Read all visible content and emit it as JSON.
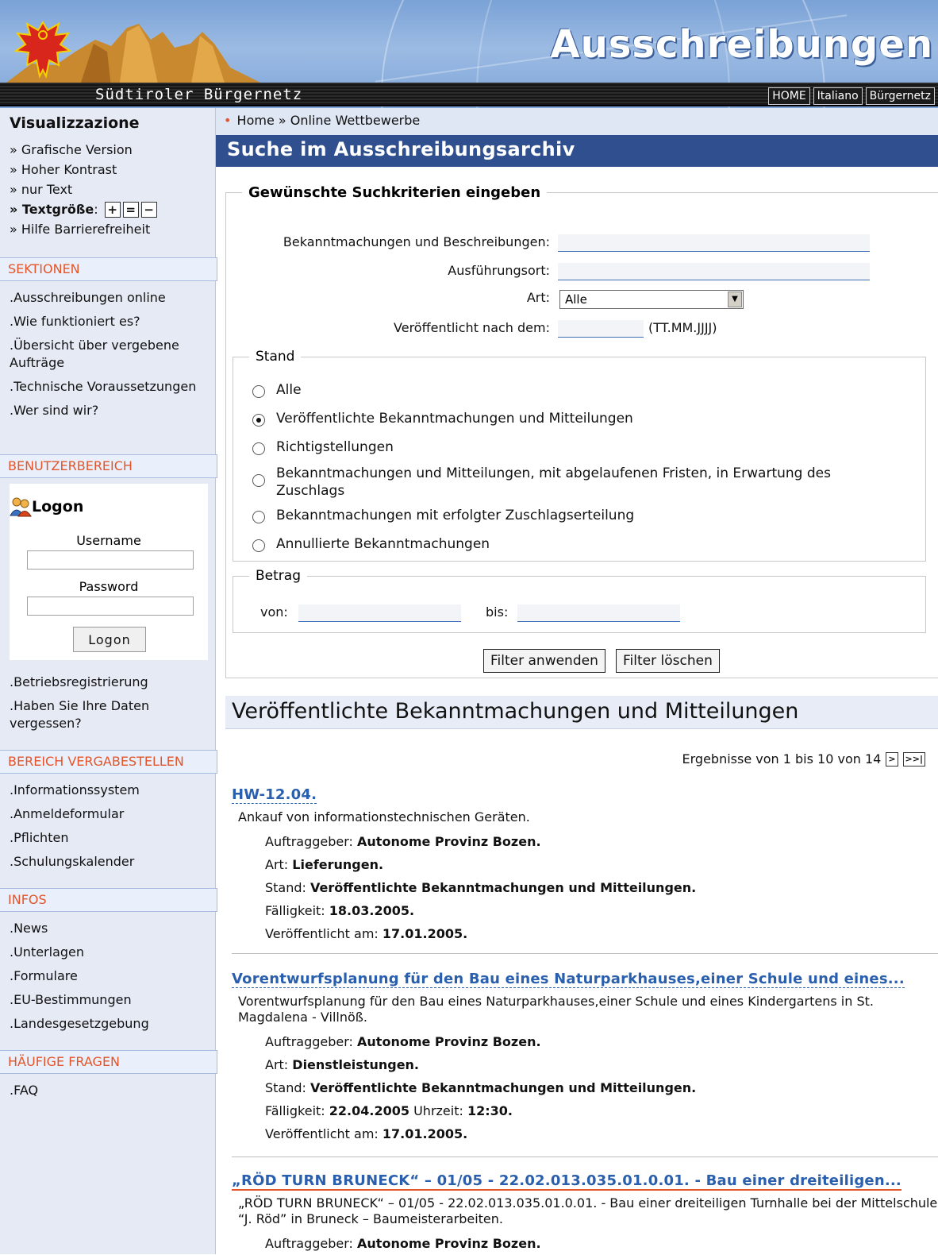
{
  "header": {
    "title": "Ausschreibungen",
    "site_name": "Südtiroler Bürgernetz",
    "links": [
      "HOME",
      "Italiano",
      "Bürgernetz"
    ]
  },
  "sidebar": {
    "visualization_title": "Visualizzazione",
    "visualization_items": [
      "» Grafische Version",
      "» Hoher Kontrast",
      "» nur Text"
    ],
    "text_size_label": "Textgröße",
    "text_size_buttons": [
      "+",
      "=",
      "−"
    ],
    "accessibility_help": "» Hilfe Barrierefreiheit",
    "sections": {
      "heading": "SEKTIONEN",
      "items": [
        ".Ausschreibungen online",
        ".Wie funktioniert es?",
        ".Übersicht über vergebene Aufträge",
        ".Technische Voraussetzungen",
        ".Wer sind wir?"
      ]
    },
    "user_area": {
      "heading": "BENUTZERBEREICH",
      "logon_title": "Logon",
      "username_label": "Username",
      "username_value": "",
      "password_label": "Password",
      "password_value": "",
      "logon_button": "Logon",
      "items": [
        ".Betriebsregistrierung",
        ".Haben Sie Ihre Daten vergessen?"
      ]
    },
    "contracting_area": {
      "heading": "BEREICH VERGABESTELLEN",
      "items": [
        ".Informationssystem",
        ".Anmeldeformular",
        ".Pflichten",
        ".Schulungskalender"
      ]
    },
    "infos": {
      "heading": "INFOS",
      "items": [
        ".News",
        ".Unterlagen",
        ".Formulare",
        ".EU-Bestimmungen",
        ".Landesgesetzgebung"
      ]
    },
    "faq": {
      "heading": "HÄUFIGE FRAGEN",
      "items": [
        ".FAQ"
      ]
    }
  },
  "breadcrumb": {
    "home": "Home",
    "sep": "»",
    "current": "Online Wettbewerbe"
  },
  "search": {
    "page_title": "Suche im Ausschreibungsarchiv",
    "legend": "Gewünschte Suchkriterien eingeben",
    "field_announcements_label": "Bekanntmachungen und Beschreibungen:",
    "field_announcements_value": "",
    "field_location_label": "Ausführungsort:",
    "field_location_value": "",
    "field_type_label": "Art:",
    "field_type_selected": "Alle",
    "field_published_label": "Veröffentlicht nach dem:",
    "field_published_value": "",
    "field_published_hint": "(TT.MM.JJJJ)",
    "status_legend": "Stand",
    "status_options": [
      "Alle",
      "Veröffentlichte Bekanntmachungen und Mitteilungen",
      "Richtigstellungen",
      "Bekanntmachungen und Mitteilungen, mit abgelaufenen Fristen, in Erwartung des Zuschlags",
      "Bekanntmachungen mit erfolgter Zuschlagserteilung",
      "Annullierte Bekanntmachungen"
    ],
    "status_selected": "Veröffentlichte Bekanntmachungen und Mitteilungen",
    "amount_legend": "Betrag",
    "amount_from_label": "von:",
    "amount_from_value": "",
    "amount_to_label": "bis:",
    "amount_to_value": "",
    "apply_button": "Filter anwenden",
    "clear_button": "Filter löschen"
  },
  "results": {
    "heading": "Veröffentlichte Bekanntmachungen und Mitteilungen",
    "pager_text": "Ergebnisse von 1 bis 10 von 14",
    "pager_next": ">",
    "pager_last": ">>|",
    "labels": {
      "client": "Auftraggeber:",
      "type": "Art:",
      "status": "Stand:",
      "due": "Fälligkeit:",
      "time": "Uhrzeit:",
      "published": "Veröffentlicht am:"
    },
    "items": [
      {
        "title": "HW-12.04.",
        "description": "Ankauf von informationstechnischen Geräten.",
        "client": "Autonome Provinz Bozen.",
        "type": "Lieferungen.",
        "status": "Veröffentlichte Bekanntmachungen und Mitteilungen.",
        "due": "18.03.2005.",
        "time": "",
        "published": "17.01.2005."
      },
      {
        "title": "Vorentwurfsplanung für den Bau eines Naturparkhauses,einer Schule und eines...",
        "description": "Vorentwurfsplanung für den Bau eines Naturparkhauses,einer Schule und eines Kindergartens in St. Magdalena - Villnöß.",
        "client": "Autonome Provinz Bozen.",
        "type": "Dienstleistungen.",
        "status": "Veröffentlichte Bekanntmachungen und Mitteilungen.",
        "due": "22.04.2005",
        "time": "12:30.",
        "published": "17.01.2005."
      },
      {
        "title": "„RÖD TURN BRUNECK“ – 01/05 - 22.02.013.035.01.0.01. - Bau einer dreiteiligen...",
        "description": "„RÖD TURN BRUNECK“ – 01/05 - 22.02.013.035.01.0.01. - Bau einer dreiteiligen Turnhalle bei der Mittelschule “J. Röd” in Bruneck – Baumeisterarbeiten.",
        "client": "Autonome Provinz Bozen."
      }
    ]
  },
  "colors": {
    "header_blue": "#7aa2d6",
    "title_bar_blue": "#2f4f8f",
    "section_orange": "#e2552a",
    "link_blue": "#2a5fae",
    "sidebar_bg": "#e5eaf5"
  }
}
